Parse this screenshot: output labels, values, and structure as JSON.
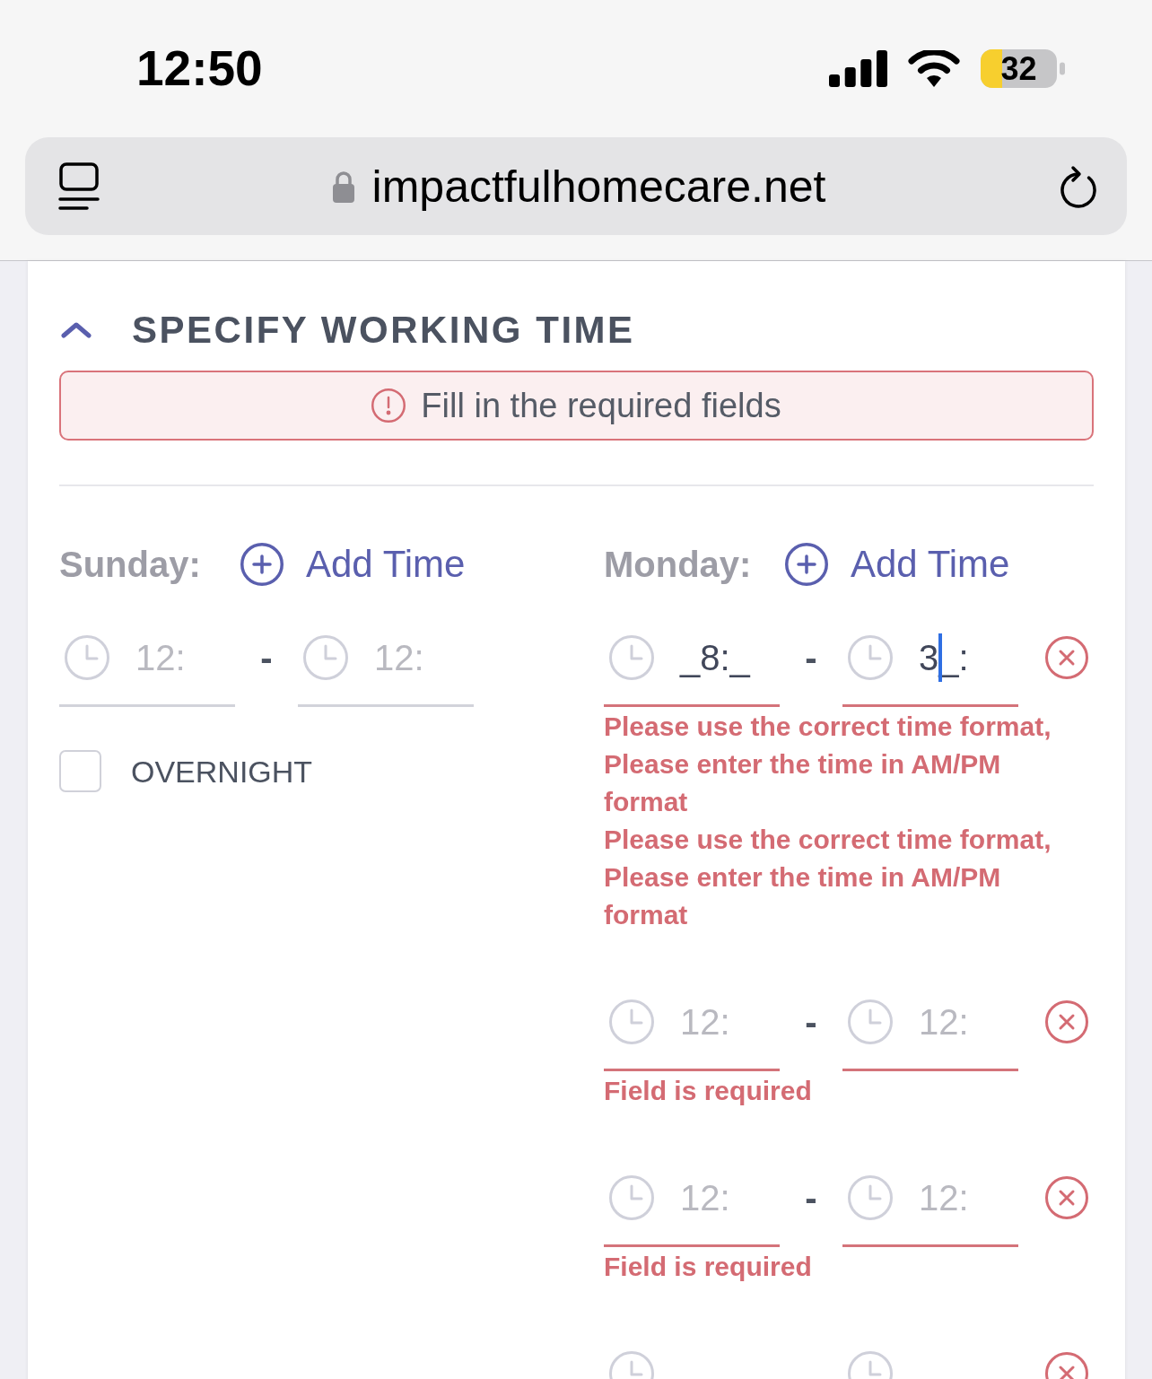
{
  "status_bar": {
    "time": "12:50",
    "battery": "32"
  },
  "browser": {
    "url": "impactfulhomecare.net"
  },
  "section": {
    "title": "SPECIFY WORKING TIME",
    "expanded": true
  },
  "alert": {
    "message": "Fill in the required fields"
  },
  "days": [
    {
      "label": "Sunday:",
      "add_button": "Add Time",
      "entries": [
        {
          "start": {
            "placeholder": "12:",
            "error": false
          },
          "separator": "-",
          "end": {
            "placeholder": "12:",
            "error": false
          }
        }
      ],
      "overnight": {
        "label": "OVERNIGHT",
        "checked": false
      }
    },
    {
      "label": "Monday:",
      "add_button": "Add Time",
      "entries": [
        {
          "start": {
            "value": "_8:_",
            "error": true
          },
          "separator": "-",
          "end": {
            "value": "3_:",
            "error": true,
            "focused": true
          },
          "removable": true,
          "errors": [
            "Please use the correct time format, Please enter the time in AM/PM format",
            "Please use the correct time format, Please enter the time in AM/PM format"
          ]
        },
        {
          "start": {
            "placeholder": "12:",
            "error": true
          },
          "separator": "-",
          "end": {
            "placeholder": "12:",
            "error": true
          },
          "removable": true,
          "errors": [
            "Field is required"
          ]
        },
        {
          "start": {
            "placeholder": "12:",
            "error": true
          },
          "separator": "-",
          "end": {
            "placeholder": "12:",
            "error": true
          },
          "removable": true,
          "errors": [
            "Field is required"
          ]
        },
        {
          "removable": true
        }
      ]
    }
  ]
}
